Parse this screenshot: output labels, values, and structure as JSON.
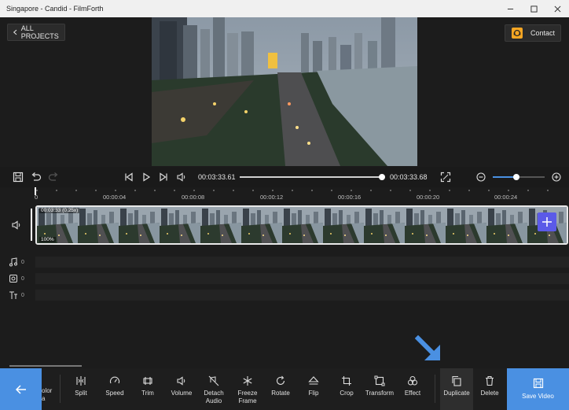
{
  "window": {
    "title": "Singapore - Candid - FilmForth"
  },
  "header": {
    "all_projects_label": "ALL PROJECTS",
    "contact_label": "Contact"
  },
  "player": {
    "current_time": "00:03:33.61",
    "end_time": "00:03:33.68",
    "progress": 1.0,
    "zoom_level": 0.45
  },
  "timeline": {
    "ruler_labels": [
      "0",
      "00:00:04",
      "00:00:08",
      "00:00:12",
      "00:00:16",
      "00:00:20",
      "00:00:24"
    ],
    "clip": {
      "duration_label": "00:03:33 (0.25x)",
      "volume_label": "100%"
    },
    "tracks": [
      {
        "icon": "music-note-icon",
        "count": "0"
      },
      {
        "icon": "sticker-icon",
        "count": "0"
      },
      {
        "icon": "text-icon",
        "count": "0"
      }
    ]
  },
  "toolbar": {
    "partial_label_1": "olor",
    "partial_label_2": "a",
    "tools": [
      {
        "id": "split",
        "label": "Split"
      },
      {
        "id": "speed",
        "label": "Speed"
      },
      {
        "id": "trim",
        "label": "Trim"
      },
      {
        "id": "volume",
        "label": "Volume"
      },
      {
        "id": "detach-audio",
        "label": "Detach Audio"
      },
      {
        "id": "freeze-frame",
        "label": "Freeze Frame"
      },
      {
        "id": "rotate",
        "label": "Rotate"
      },
      {
        "id": "flip",
        "label": "Flip"
      },
      {
        "id": "crop",
        "label": "Crop"
      },
      {
        "id": "transform",
        "label": "Transform"
      },
      {
        "id": "effect",
        "label": "Effect"
      },
      {
        "id": "duplicate",
        "label": "Duplicate"
      },
      {
        "id": "delete",
        "label": "Delete"
      }
    ],
    "save_label": "Save Video"
  },
  "colors": {
    "accent": "#4a90e2",
    "add_clip": "#5b5ae8",
    "contact_icon": "#f5a623"
  }
}
